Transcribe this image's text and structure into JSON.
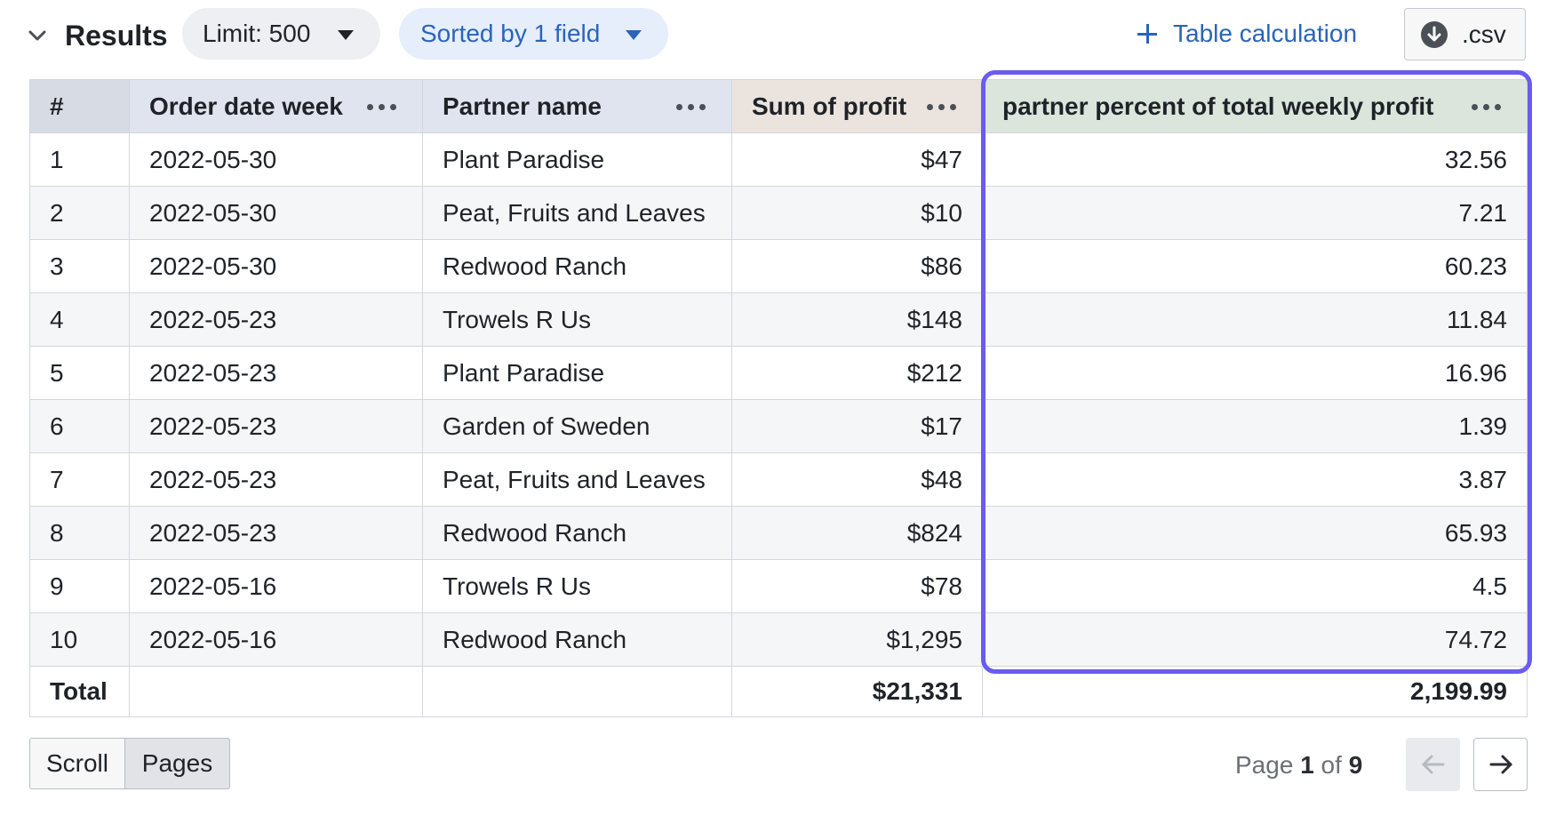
{
  "header": {
    "title": "Results",
    "limit_label": "Limit: 500",
    "sort_label": "Sorted by 1 field",
    "table_calc_label": "Table calculation",
    "csv_label": ".csv"
  },
  "table": {
    "columns": [
      {
        "label": "#"
      },
      {
        "label": "Order date week"
      },
      {
        "label": "Partner name"
      },
      {
        "label": "Sum of profit"
      },
      {
        "label": "partner percent of total weekly profit"
      }
    ],
    "rows": [
      [
        "1",
        "2022-05-30",
        "Plant Paradise",
        "$47",
        "32.56"
      ],
      [
        "2",
        "2022-05-30",
        "Peat, Fruits and Leaves",
        "$10",
        "7.21"
      ],
      [
        "3",
        "2022-05-30",
        "Redwood Ranch",
        "$86",
        "60.23"
      ],
      [
        "4",
        "2022-05-23",
        "Trowels R Us",
        "$148",
        "11.84"
      ],
      [
        "5",
        "2022-05-23",
        "Plant Paradise",
        "$212",
        "16.96"
      ],
      [
        "6",
        "2022-05-23",
        "Garden of Sweden",
        "$17",
        "1.39"
      ],
      [
        "7",
        "2022-05-23",
        "Peat, Fruits and Leaves",
        "$48",
        "3.87"
      ],
      [
        "8",
        "2022-05-23",
        "Redwood Ranch",
        "$824",
        "65.93"
      ],
      [
        "9",
        "2022-05-16",
        "Trowels R Us",
        "$78",
        "4.5"
      ],
      [
        "10",
        "2022-05-16",
        "Redwood Ranch",
        "$1,295",
        "74.72"
      ]
    ],
    "totals": {
      "label": "Total",
      "sum_of_profit": "$21,331",
      "percent_total": "2,199.99"
    }
  },
  "footer": {
    "scroll_label": "Scroll",
    "pages_label": "Pages",
    "page_prefix": "Page",
    "current_page": "1",
    "page_of": "of",
    "total_pages": "9"
  },
  "colors": {
    "accent_blue": "#2b64b8",
    "highlight_purple": "#6a5cf0"
  }
}
